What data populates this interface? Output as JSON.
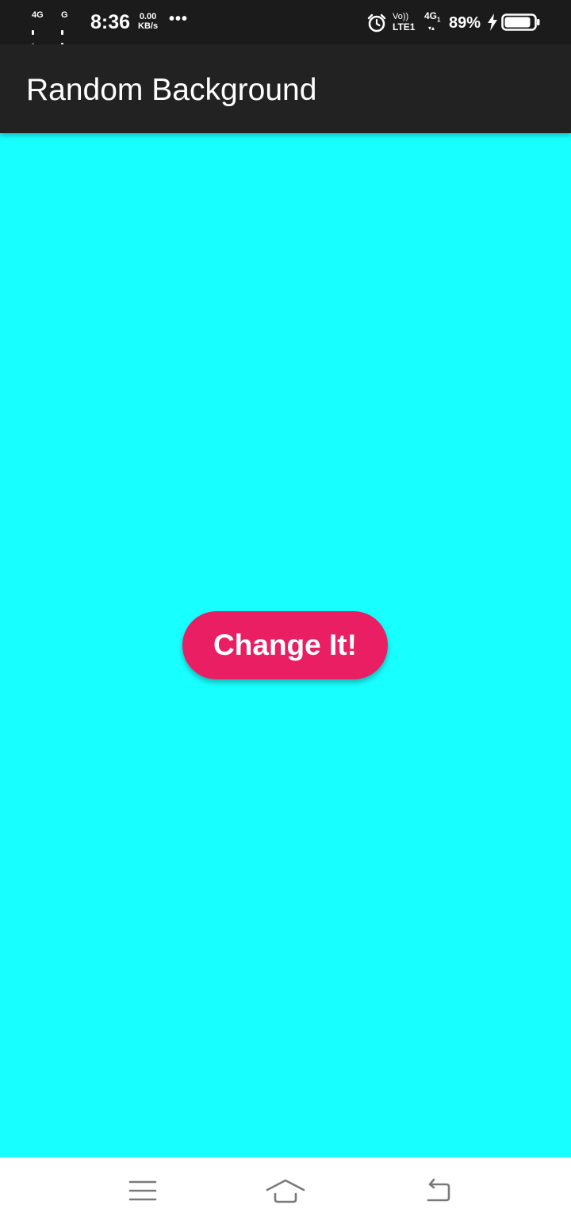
{
  "status_bar": {
    "sim1_network": "4G",
    "sim2_network": "G",
    "time": "8:36",
    "net_speed_value": "0.00",
    "net_speed_unit": "KB/s",
    "more_indicator": "•••",
    "volte_top": "Vo))",
    "volte_bottom": "LTE1",
    "network_type": "4G",
    "network_subscript": "1",
    "battery_percent": "89%",
    "battery_level": 0.89,
    "icons": [
      "alarm-icon",
      "charging-bolt-icon",
      "battery-icon"
    ]
  },
  "app_bar": {
    "title": "Random Background"
  },
  "content": {
    "background_color": "#18ffff",
    "button_label": "Change It!",
    "button_color": "#e91e63"
  },
  "nav_bar": {
    "icons": [
      "menu-icon",
      "home-icon",
      "back-icon"
    ]
  }
}
